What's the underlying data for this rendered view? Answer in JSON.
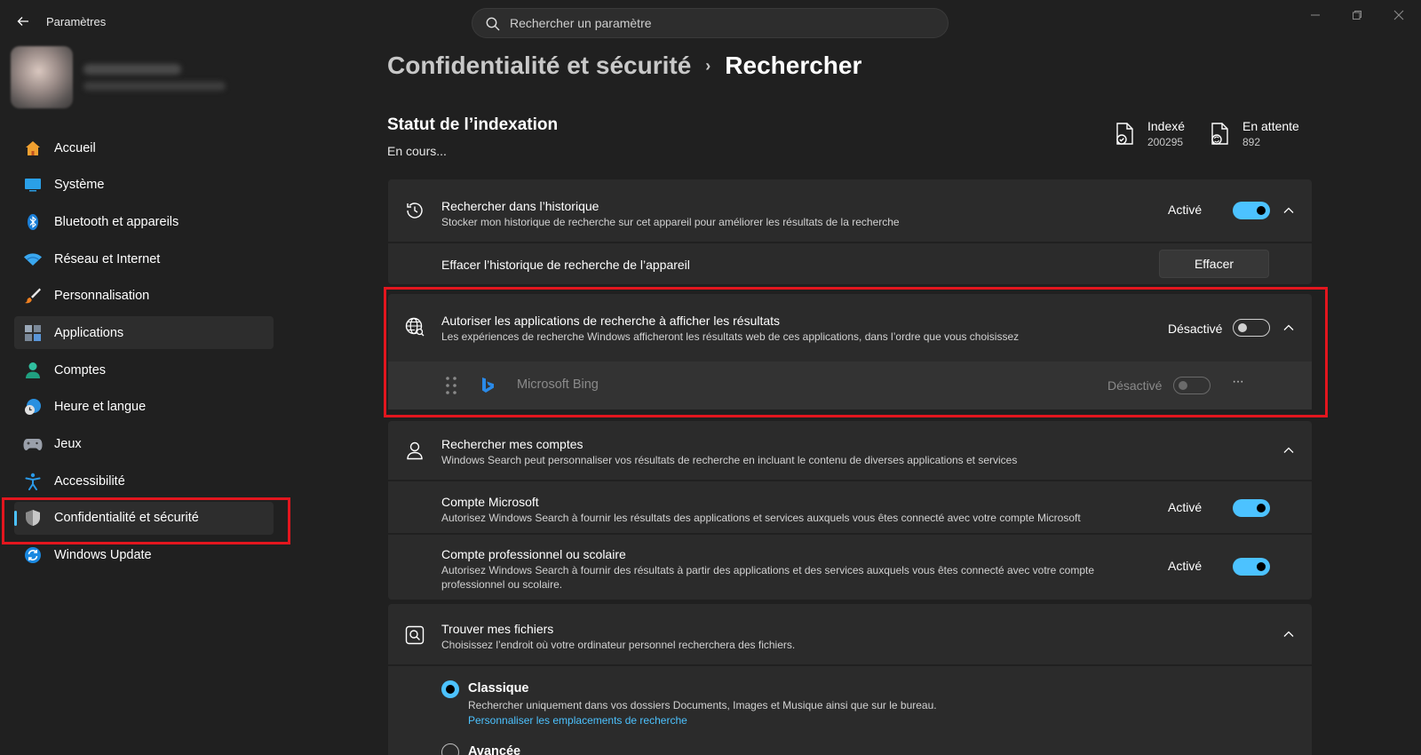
{
  "window": {
    "title": "Paramètres",
    "search_placeholder": "Rechercher un paramètre"
  },
  "sidebar": {
    "items": [
      {
        "label": "Accueil",
        "icon": "home-icon"
      },
      {
        "label": "Système",
        "icon": "display-icon"
      },
      {
        "label": "Bluetooth et appareils",
        "icon": "bluetooth-icon"
      },
      {
        "label": "Réseau et Internet",
        "icon": "wifi-icon"
      },
      {
        "label": "Personnalisation",
        "icon": "brush-icon"
      },
      {
        "label": "Applications",
        "icon": "apps-icon"
      },
      {
        "label": "Comptes",
        "icon": "person-icon"
      },
      {
        "label": "Heure et langue",
        "icon": "clock-globe-icon"
      },
      {
        "label": "Jeux",
        "icon": "gamepad-icon"
      },
      {
        "label": "Accessibilité",
        "icon": "accessibility-icon"
      },
      {
        "label": "Confidentialité et sécurité",
        "icon": "shield-icon"
      },
      {
        "label": "Windows Update",
        "icon": "update-icon"
      }
    ],
    "active_index": 10,
    "hover_index": 5
  },
  "breadcrumb": {
    "parent": "Confidentialité et sécurité",
    "separator": "›",
    "current": "Rechercher"
  },
  "indexing": {
    "title": "Statut de l’indexation",
    "status": "En cours...",
    "indexed_label": "Indexé",
    "indexed_value": "200295",
    "pending_label": "En attente",
    "pending_value": "892"
  },
  "history": {
    "title": "Rechercher dans l’historique",
    "desc": "Stocker mon historique de recherche sur cet appareil pour améliorer les résultats de la recherche",
    "state": "Activé",
    "clear_title": "Effacer l’historique de recherche de l’appareil",
    "clear_button": "Effacer"
  },
  "search_apps": {
    "title": "Autoriser les applications de recherche à afficher les résultats",
    "desc": "Les expériences de recherche Windows afficheront les résultats web de ces applications, dans l’ordre que vous choisissez",
    "state": "Désactivé",
    "app_name": "Microsoft Bing",
    "app_state": "Désactivé",
    "more": "···"
  },
  "accounts": {
    "title": "Rechercher mes comptes",
    "desc": "Windows Search peut personnaliser vos résultats de recherche en incluant le contenu de diverses applications et services",
    "microsoft_title": "Compte Microsoft",
    "microsoft_desc": "Autorisez Windows Search à fournir les résultats des applications et services auxquels vous êtes connecté avec votre compte Microsoft",
    "microsoft_state": "Activé",
    "work_title": "Compte professionnel ou scolaire",
    "work_desc_1": "Autorisez Windows Search à fournir des résultats à partir des applications et des services auxquels vous êtes connecté avec votre compte",
    "work_desc_2": "professionnel ou scolaire.",
    "work_state": "Activé"
  },
  "files": {
    "title": "Trouver mes fichiers",
    "desc": "Choisissez l’endroit où votre ordinateur personnel recherchera des fichiers.",
    "classic_title": "Classique",
    "classic_desc": "Rechercher uniquement dans vos dossiers Documents, Images et Musique ainsi que sur le bureau.",
    "classic_link": "Personnaliser les emplacements de recherche",
    "enhanced_title": "Avancée"
  },
  "colors": {
    "accent": "#4cc2ff",
    "highlight": "#e3161e"
  }
}
